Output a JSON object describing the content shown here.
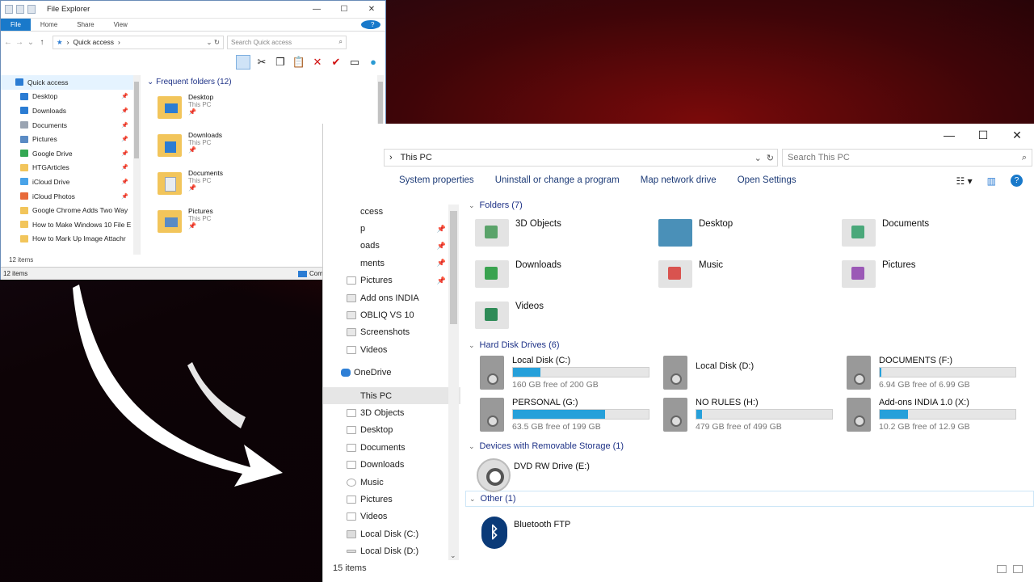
{
  "old_window": {
    "title": "File Explorer",
    "window_controls": [
      "—",
      "☐",
      "✕"
    ],
    "tabs": [
      "File",
      "Home",
      "Share",
      "View"
    ],
    "help": "?",
    "breadcrumb": "Quick access",
    "search_placeholder": "Search Quick access",
    "nav_items": [
      {
        "label": "Quick access",
        "color": "#2b7cd3"
      },
      {
        "label": "Desktop",
        "color": "#2b7cd3"
      },
      {
        "label": "Downloads",
        "color": "#2b7cd3"
      },
      {
        "label": "Documents",
        "color": "#9aa4b2"
      },
      {
        "label": "Pictures",
        "color": "#5a8bc4"
      },
      {
        "label": "Google Drive",
        "color": "#34a853"
      },
      {
        "label": "HTGArticles",
        "color": "#f2c55b"
      },
      {
        "label": "iCloud Drive",
        "color": "#4aa3e8"
      },
      {
        "label": "iCloud Photos",
        "color": "#e86a3a"
      },
      {
        "label": "Google Chrome Adds Two Way",
        "color": "#f2c55b"
      },
      {
        "label": "How to Make Windows 10 File E",
        "color": "#f2c55b"
      },
      {
        "label": "How to Mark Up Image Attachr",
        "color": "#f2c55b"
      }
    ],
    "section_title": "Frequent folders (12)",
    "folders": [
      {
        "name": "Desktop",
        "location": "This PC",
        "badge_color": "#2b7cd3"
      },
      {
        "name": "Downloads",
        "location": "This PC",
        "badge_color": "#2b7cd3"
      },
      {
        "name": "Documents",
        "location": "This PC",
        "badge_color": "#9aa4b2"
      },
      {
        "name": "Pictures",
        "location": "This PC",
        "badge_color": "#5a8bc4"
      }
    ],
    "item_count": "12 items",
    "status_count": "12 items",
    "status_location": "Computer"
  },
  "new_window": {
    "window_controls": [
      "—",
      "☐",
      "✕"
    ],
    "breadcrumb": "This PC",
    "search_placeholder": "Search This PC",
    "ribbon": [
      "System properties",
      "Uninstall or change a program",
      "Map network drive",
      "Open Settings"
    ],
    "nav_items": [
      {
        "label": "ccess",
        "pin": false
      },
      {
        "label": "p",
        "pin": true
      },
      {
        "label": "oads",
        "pin": true
      },
      {
        "label": "ments",
        "pin": true
      },
      {
        "label": "Pictures",
        "pin": true
      },
      {
        "label": "Add ons INDIA",
        "pin": false
      },
      {
        "label": "OBLIQ VS 10",
        "pin": false
      },
      {
        "label": "Screenshots",
        "pin": false
      },
      {
        "label": "Videos",
        "pin": false
      }
    ],
    "onedrive": "OneDrive",
    "this_pc": "This PC",
    "pc_items": [
      "3D Objects",
      "Desktop",
      "Documents",
      "Downloads",
      "Music",
      "Pictures",
      "Videos",
      "Local Disk (C:)",
      "Local Disk (D:)"
    ],
    "sections": {
      "folders": "Folders (7)",
      "drives": "Hard Disk Drives (6)",
      "removable": "Devices with Removable Storage (1)",
      "other": "Other (1)"
    },
    "folders": [
      {
        "name": "3D Objects",
        "color": "#5aa36a"
      },
      {
        "name": "Desktop",
        "color": "#4a90b8"
      },
      {
        "name": "Documents",
        "color": "#4aa87a"
      },
      {
        "name": "Downloads",
        "color": "#3aa350"
      },
      {
        "name": "Music",
        "color": "#d9534f"
      },
      {
        "name": "Pictures",
        "color": "#9b59b6"
      },
      {
        "name": "Videos",
        "color": "#2e8b57"
      }
    ],
    "drives": [
      {
        "name": "Local Disk (C:)",
        "free": "160 GB free of 200 GB",
        "used_fraction": 0.2
      },
      {
        "name": "Local Disk (D:)",
        "free": "",
        "used_fraction": null
      },
      {
        "name": "DOCUMENTS (F:)",
        "free": "6.94 GB free of 6.99 GB",
        "used_fraction": 0.01
      },
      {
        "name": "PERSONAL (G:)",
        "free": "63.5 GB free of 199 GB",
        "used_fraction": 0.68
      },
      {
        "name": "NO RULES (H:)",
        "free": "479 GB free of 499 GB",
        "used_fraction": 0.04
      },
      {
        "name": "Add-ons INDIA 1.0 (X:)",
        "free": "10.2 GB free of 12.9 GB",
        "used_fraction": 0.21
      }
    ],
    "removable": "DVD RW Drive (E:)",
    "other_item": "Bluetooth FTP",
    "status": "15 items"
  }
}
